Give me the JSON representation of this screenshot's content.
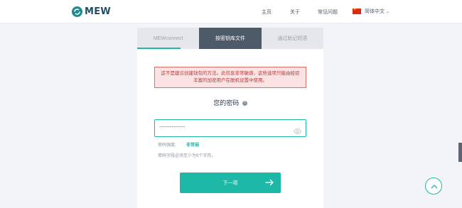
{
  "header": {
    "brand": "MEW",
    "nav": [
      "主页",
      "关于",
      "常见问题"
    ],
    "language": "简体中文"
  },
  "tabs": [
    "MEWconnect",
    "按密钥库文件",
    "通过助记短语"
  ],
  "warning": "这不是建议创建钱包的方法。此信息非常敏感，这些选项只能由经验丰富的加密用户在脱机设置中使用。",
  "password_section": {
    "title": "您的密码",
    "value": "·····················",
    "strength_label": "密码强度:",
    "strength_value": "非常弱",
    "hint": "密码字段必须至少为9个字符。"
  },
  "next_button": "下一项",
  "icons": [
    "logo-icon",
    "flag-icon",
    "chevron-down-icon",
    "info-icon",
    "eye-icon",
    "arrow-right-icon",
    "arrow-up-icon"
  ],
  "colors": {
    "accent": "#1eb8a6",
    "tab_selected": "#4d5a68",
    "warning_bg": "#fbe3e3",
    "warning_border": "#e06b6b"
  }
}
